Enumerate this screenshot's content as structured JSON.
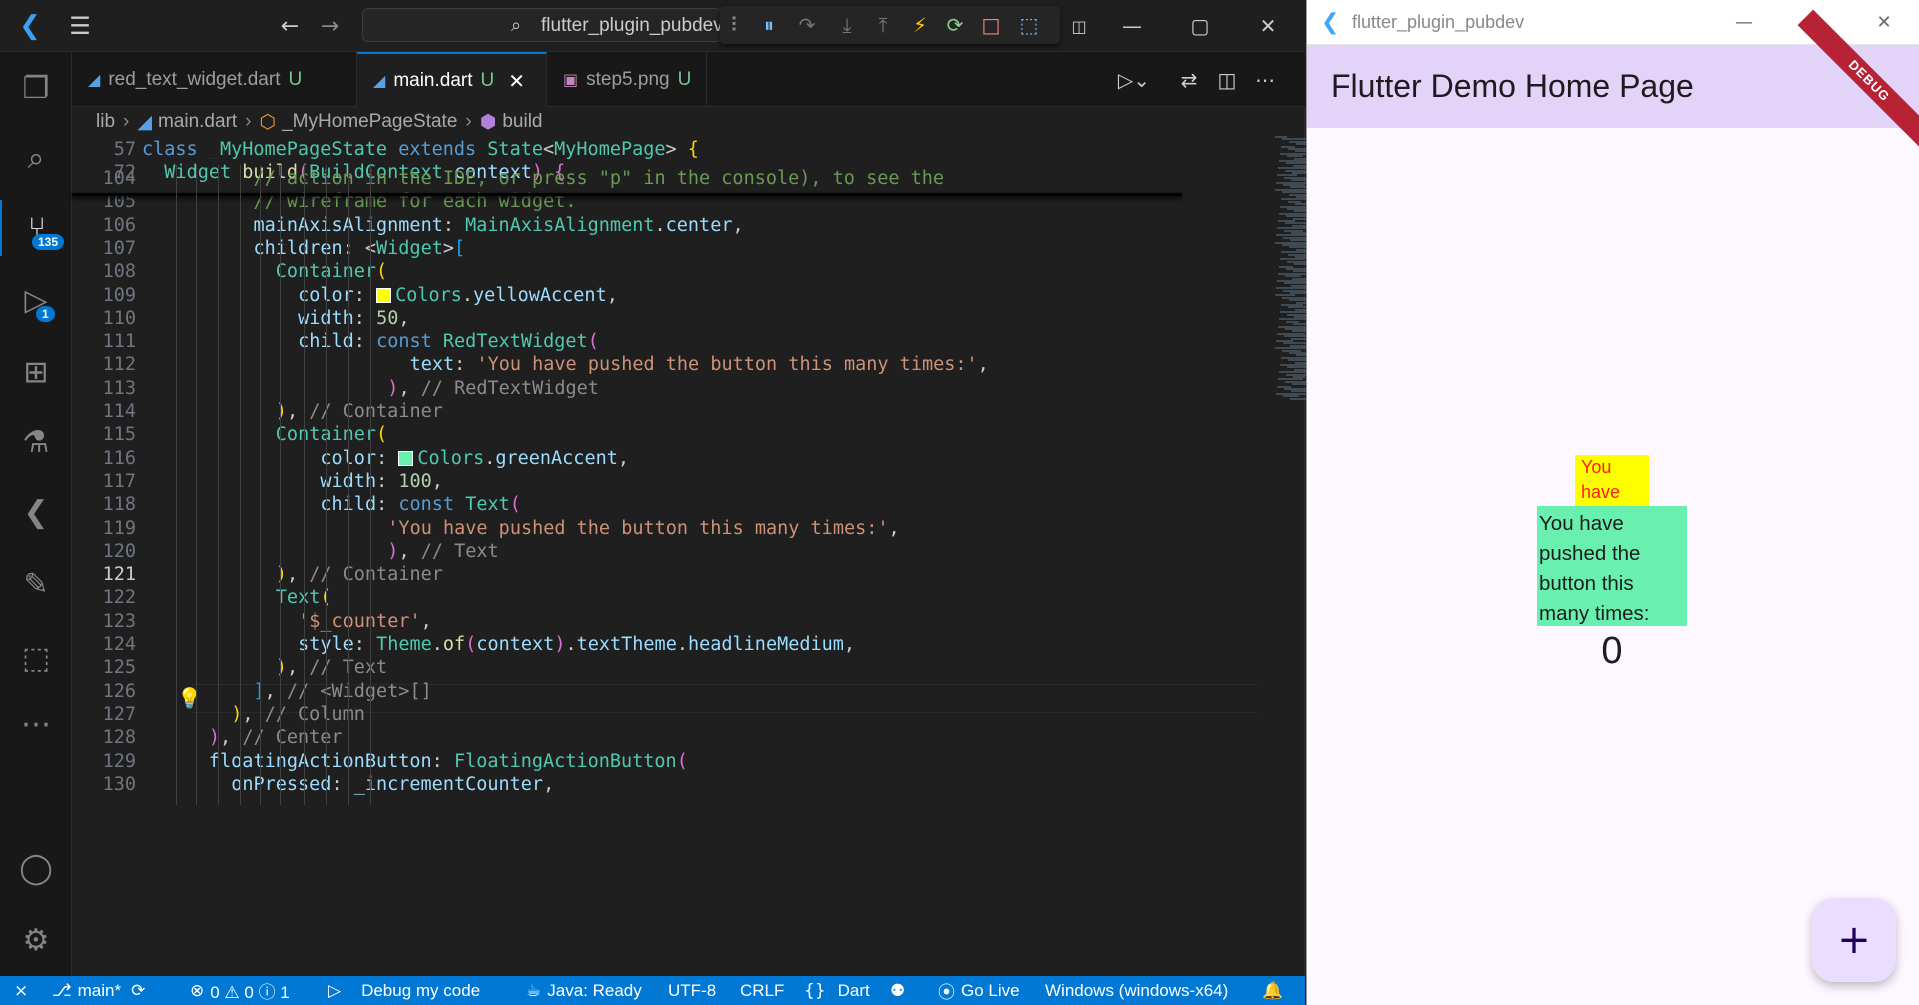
{
  "vscode": {
    "command_center": "flutter_plugin_pubdev",
    "tabs": [
      {
        "label": "red_text_widget.dart",
        "status": "U"
      },
      {
        "label": "main.dart",
        "status": "U"
      },
      {
        "label": "step5.png",
        "status": "U"
      }
    ],
    "breadcrumb": [
      "lib",
      "main.dart",
      "_MyHomePageState",
      "build"
    ],
    "activity_badges": {
      "source_control": "135",
      "run_debug": "1"
    },
    "status_bar": {
      "branch": "main*",
      "problems": "0 ⚠ 0 ⓘ 1",
      "errors": "0",
      "debug": "Debug my code",
      "java": "Java: Ready",
      "encoding": "UTF-8",
      "eol": "CRLF",
      "language": "Dart",
      "live": "Go Live",
      "device": "Windows (windows-x64)"
    }
  },
  "code_lines": [
    {
      "n": "57",
      "sticky": true
    },
    {
      "n": "72",
      "sticky": true
    },
    {
      "n": "104"
    },
    {
      "n": "105"
    },
    {
      "n": "106"
    },
    {
      "n": "107"
    },
    {
      "n": "108"
    },
    {
      "n": "109"
    },
    {
      "n": "110"
    },
    {
      "n": "111"
    },
    {
      "n": "112"
    },
    {
      "n": "113"
    },
    {
      "n": "114"
    },
    {
      "n": "115"
    },
    {
      "n": "116"
    },
    {
      "n": "117"
    },
    {
      "n": "118"
    },
    {
      "n": "119"
    },
    {
      "n": "120"
    },
    {
      "n": "121"
    },
    {
      "n": "122"
    },
    {
      "n": "123"
    },
    {
      "n": "124"
    },
    {
      "n": "125"
    },
    {
      "n": "126"
    },
    {
      "n": "127"
    },
    {
      "n": "128"
    },
    {
      "n": "129"
    },
    {
      "n": "130"
    }
  ],
  "code_text": {
    "l57": [
      "class",
      "_MyHomePageState",
      "extends",
      "State",
      "<",
      "MyHomePage",
      ">",
      " {"
    ],
    "l72": [
      "Widget",
      "build",
      "(",
      "BuildContext",
      "context",
      ")",
      " {"
    ],
    "l104": "// action in the IDE, or press \"p\" in the console), to see the",
    "l105": "// wireframe for each widget.",
    "l106": [
      "mainAxisAlignment",
      ": ",
      "MainAxisAlignment",
      ".",
      "center",
      ","
    ],
    "l107": [
      "children",
      ": <",
      "Widget",
      ">",
      "["
    ],
    "l108": [
      "Container",
      "("
    ],
    "l109": [
      "color",
      ": ",
      "Colors",
      ".",
      "yellowAccent",
      ","
    ],
    "l110": [
      "width",
      ": ",
      "50",
      ","
    ],
    "l111": [
      "child",
      ": ",
      "const",
      "RedTextWidget",
      "("
    ],
    "l112": [
      "text",
      ": ",
      "'You have pushed the button this many times:'",
      ","
    ],
    "l113": [
      ")",
      ", ",
      "// RedTextWidget"
    ],
    "l114": [
      ")",
      ", ",
      "// Container"
    ],
    "l115": [
      "Container",
      "("
    ],
    "l116": [
      "color",
      ": ",
      "Colors",
      ".",
      "greenAccent",
      ","
    ],
    "l117": [
      "width",
      ": ",
      "100",
      ","
    ],
    "l118": [
      "child",
      ": ",
      "const",
      "Text",
      "("
    ],
    "l119": [
      "'You have pushed the button this many times:'",
      ","
    ],
    "l120": [
      ")",
      ", ",
      "// Text"
    ],
    "l121": [
      ")",
      ",",
      "// Container"
    ],
    "l122": [
      "Text",
      "("
    ],
    "l123": [
      "'$_counter'",
      ","
    ],
    "l124": [
      "style",
      ": ",
      "Theme",
      ".",
      "of",
      "(",
      "context",
      ")",
      ".",
      "textTheme",
      ".",
      "headlineMedium",
      ","
    ],
    "l125": [
      ")",
      ", ",
      "// Text"
    ],
    "l126": [
      "]",
      ", ",
      "// <Widget>[]"
    ],
    "l127": [
      ")",
      ", ",
      "// Column"
    ],
    "l128": [
      ")",
      ", ",
      "// Center"
    ],
    "l129": [
      "floatingActionButton",
      ": ",
      "FloatingActionButton",
      "("
    ],
    "l130": [
      "onPressed",
      ": ",
      "_incrementCounter",
      ","
    ]
  },
  "swatches": {
    "yellow": "#ffff00",
    "green": "#69f0ae"
  },
  "flutter_app": {
    "window_title": "flutter_plugin_pubdev",
    "appbar_title": "Flutter Demo Home Page",
    "debug_banner": "DEBUG",
    "red_text": "You have pushed the button this many times:",
    "green_text": "You have pushed the button this many times:",
    "counter": "0",
    "fab_label": "+"
  }
}
